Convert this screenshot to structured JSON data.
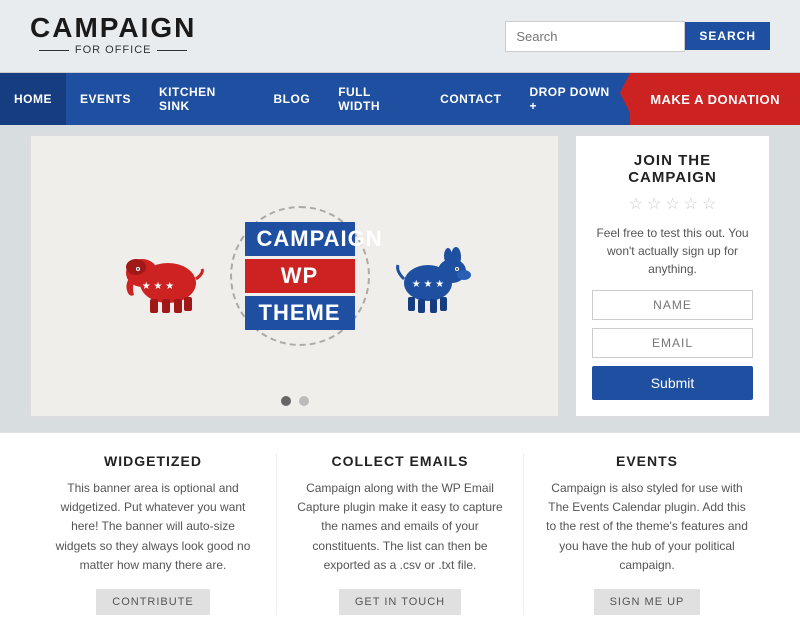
{
  "header": {
    "logo_main": "CAMPAIGN",
    "logo_sub": "For Office",
    "search_placeholder": "Search",
    "search_btn": "SEARCH"
  },
  "nav": {
    "items": [
      {
        "label": "HOME",
        "active": true
      },
      {
        "label": "EVENTS",
        "active": false
      },
      {
        "label": "KITCHEN SINK",
        "active": false
      },
      {
        "label": "BLOG",
        "active": false
      },
      {
        "label": "FULL WIDTH",
        "active": false
      },
      {
        "label": "CONTACT",
        "active": false
      },
      {
        "label": "DROP DOWN +",
        "active": false
      }
    ],
    "donate_label": "MAKE A DONATION"
  },
  "slider": {
    "campaign_label": "CAMPAIGN",
    "wp_label": "WP",
    "theme_label": "THEME",
    "dots": [
      true,
      false
    ]
  },
  "sidebar": {
    "join_title": "JOIN THE CAMPAIGN",
    "stars": [
      "★",
      "★",
      "★",
      "★",
      "★"
    ],
    "description": "Feel free to test this out. You won't actually sign up for anything.",
    "name_placeholder": "NAME",
    "email_placeholder": "EMAIL",
    "submit_label": "Submit"
  },
  "features": [
    {
      "title": "WIDGETIZED",
      "text": "This banner area is optional and widgetized. Put whatever you want here! The banner will auto-size widgets so they always look good no matter how many there are.",
      "btn": "CONTRIBUTE"
    },
    {
      "title": "COLLECT EMAILS",
      "text": "Campaign along with the WP Email Capture plugin make it easy to capture the names and emails of your constituents. The list can then be exported as a .csv or .txt file.",
      "btn": "GET IN TOUCH"
    },
    {
      "title": "EVENTS",
      "text": "Campaign is also styled for use with The Events Calendar plugin. Add this to the rest of the theme's features and you have the hub of your political campaign.",
      "btn": "SIGN ME UP"
    }
  ]
}
